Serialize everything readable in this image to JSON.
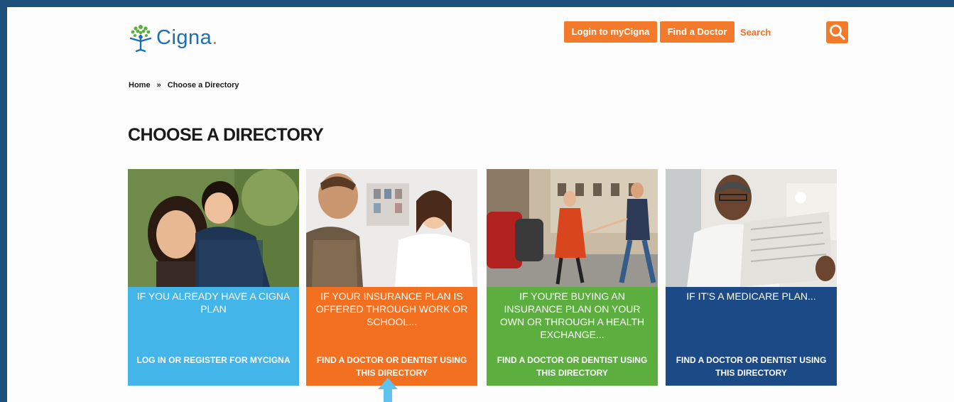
{
  "header": {
    "logo_text": "Cigna",
    "logo_dot": ".",
    "login_button": "Login to myCigna",
    "find_doctor_button": "Find a Doctor",
    "search_label": "Search"
  },
  "breadcrumb": {
    "home": "Home",
    "separator": "»",
    "current": "Choose a Directory"
  },
  "page_title": "CHOOSE A DIRECTORY",
  "cards": [
    {
      "heading": "IF YOU ALREADY HAVE A CIGNA PLAN",
      "cta": "LOG IN OR REGISTER FOR MYCIGNA",
      "color": "#43b5e8"
    },
    {
      "heading": "IF YOUR INSURANCE PLAN IS OFFERED THROUGH WORK OR SCHOOL...",
      "cta": "FIND A DOCTOR OR DENTIST USING THIS DIRECTORY",
      "color": "#f37021"
    },
    {
      "heading": "IF YOU'RE BUYING AN INSURANCE PLAN ON YOUR OWN OR THROUGH A HEALTH EXCHANGE...",
      "cta": "FIND A DOCTOR OR DENTIST USING THIS DIRECTORY",
      "color": "#5cae3f"
    },
    {
      "heading": "IF IT'S A MEDICARE PLAN...",
      "cta": "FIND A DOCTOR OR DENTIST USING THIS DIRECTORY",
      "color": "#1c4a86"
    }
  ],
  "icons": {
    "logo": "cigna-tree-logo",
    "search": "search-icon",
    "annotation": "arrow-up-icon"
  },
  "colors": {
    "brand_blue": "#1b6fb3",
    "brand_orange": "#f37021",
    "frame": "#1d4f7c"
  }
}
